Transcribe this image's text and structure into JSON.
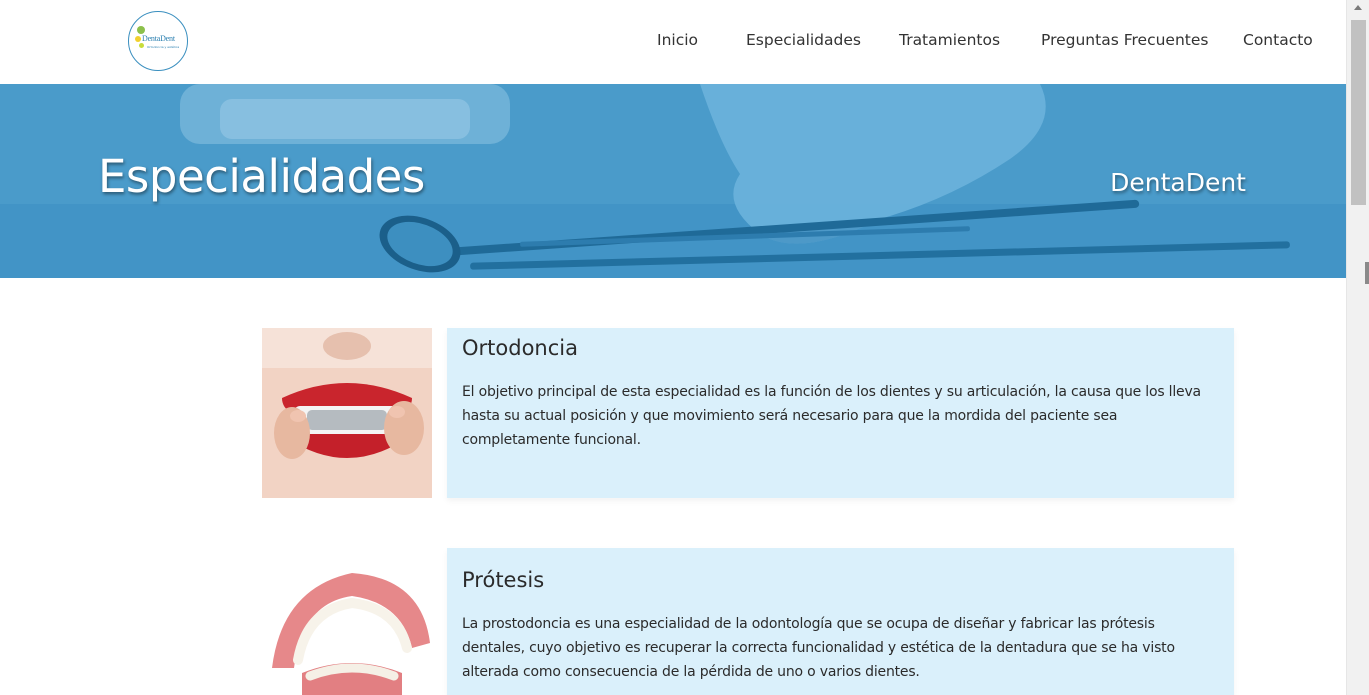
{
  "logo": {
    "name": "DentaDent",
    "tagline": "Ortodoncia y estética"
  },
  "nav": [
    "Inicio",
    "Especialidades",
    "Tratamientos",
    "Preguntas Frecuentes",
    "Contacto"
  ],
  "hero": {
    "title": "Especialidades",
    "brand": "DentaDent"
  },
  "specialties": [
    {
      "title": "Ortodoncia",
      "text": "El objetivo principal de esta especialidad es la función de los dientes y su articulación, la causa que los lleva hasta su actual posición y que movimiento será necesario para que la mordida del paciente sea completamente funcional.",
      "image_icon": "orthodontic-aligner-photo"
    },
    {
      "title": "Prótesis",
      "text": "La prostodoncia es una especialidad de la odontología que se ocupa de diseñar y fabricar las prótesis dentales, cuyo objetivo es recuperar la correcta funcionalidad y estética de la dentadura que se ha visto alterada como consecuencia de la pérdida de uno o varios dientes.",
      "image_icon": "denture-photo"
    }
  ],
  "colors": {
    "hero_blue": "#3a8fc2",
    "card_bg": "#daf0fb",
    "logo_blue": "#2a7fb0"
  }
}
